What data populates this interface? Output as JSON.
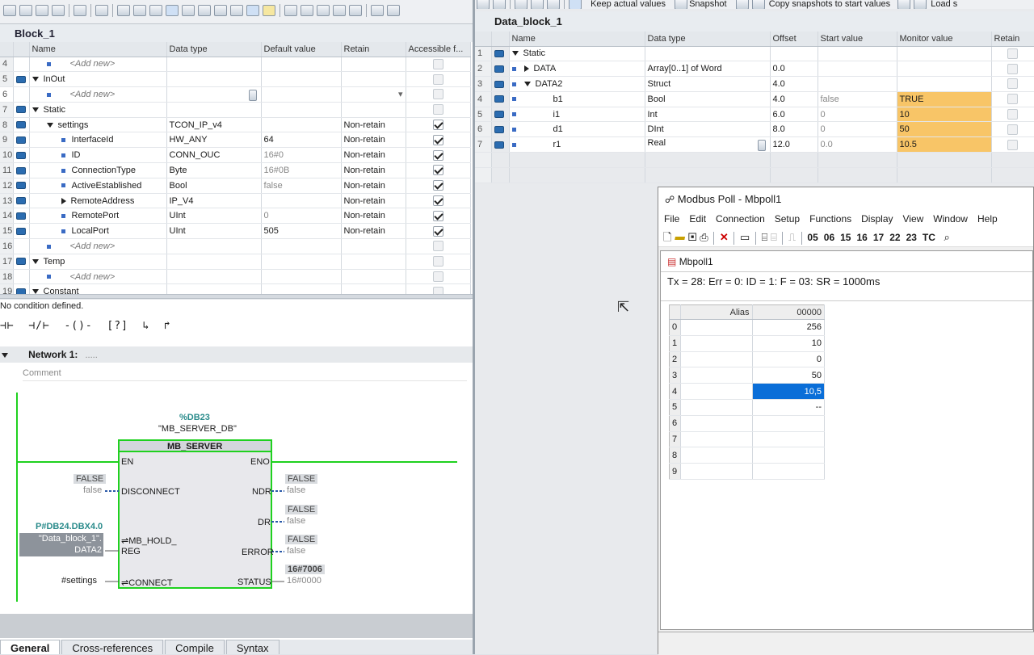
{
  "left": {
    "block_title": "Block_1",
    "columns": [
      "Name",
      "Data type",
      "Default value",
      "Retain",
      "Accessible f..."
    ],
    "rows": [
      {
        "num": "4",
        "indent": 1,
        "kind": "add",
        "name": "<Add new>",
        "type": "",
        "def": "",
        "retain": "",
        "cb": "dis"
      },
      {
        "num": "5",
        "indent": 0,
        "kind": "sec",
        "name": "InOut",
        "type": "",
        "def": "",
        "retain": "",
        "cb": "dis"
      },
      {
        "num": "6",
        "indent": 1,
        "kind": "add",
        "name": "<Add new>",
        "type": "",
        "def": "",
        "retain": "",
        "cb": "dis",
        "sel": true
      },
      {
        "num": "7",
        "indent": 0,
        "kind": "sec",
        "name": "Static",
        "type": "",
        "def": "",
        "retain": "",
        "cb": "dis"
      },
      {
        "num": "8",
        "indent": 1,
        "kind": "struct",
        "name": "settings",
        "type": "TCON_IP_v4",
        "def": "",
        "retain": "Non-retain",
        "cb": "on"
      },
      {
        "num": "9",
        "indent": 2,
        "kind": "var",
        "name": "InterfaceId",
        "type": "HW_ANY",
        "def": "64",
        "retain": "Non-retain",
        "cb": "on"
      },
      {
        "num": "10",
        "indent": 2,
        "kind": "var",
        "name": "ID",
        "type": "CONN_OUC",
        "def": "16#0",
        "retain": "Non-retain",
        "cb": "on",
        "grey": true
      },
      {
        "num": "11",
        "indent": 2,
        "kind": "var",
        "name": "ConnectionType",
        "type": "Byte",
        "def": "16#0B",
        "retain": "Non-retain",
        "cb": "on",
        "grey": true
      },
      {
        "num": "12",
        "indent": 2,
        "kind": "var",
        "name": "ActiveEstablished",
        "type": "Bool",
        "def": "false",
        "retain": "Non-retain",
        "cb": "on",
        "grey": true
      },
      {
        "num": "13",
        "indent": 2,
        "kind": "sub",
        "name": "RemoteAddress",
        "type": "IP_V4",
        "def": "",
        "retain": "Non-retain",
        "cb": "on"
      },
      {
        "num": "14",
        "indent": 2,
        "kind": "var",
        "name": "RemotePort",
        "type": "UInt",
        "def": "0",
        "retain": "Non-retain",
        "cb": "on",
        "grey": true
      },
      {
        "num": "15",
        "indent": 2,
        "kind": "var",
        "name": "LocalPort",
        "type": "UInt",
        "def": "505",
        "retain": "Non-retain",
        "cb": "on"
      },
      {
        "num": "16",
        "indent": 1,
        "kind": "add",
        "name": "<Add new>",
        "type": "",
        "def": "",
        "retain": "",
        "cb": "dis"
      },
      {
        "num": "17",
        "indent": 0,
        "kind": "sec",
        "name": "Temp",
        "type": "",
        "def": "",
        "retain": "",
        "cb": "dis"
      },
      {
        "num": "18",
        "indent": 1,
        "kind": "add",
        "name": "<Add new>",
        "type": "",
        "def": "",
        "retain": "",
        "cb": "dis"
      },
      {
        "num": "19",
        "indent": 0,
        "kind": "sec",
        "name": "Constant",
        "type": "",
        "def": "",
        "retain": "",
        "cb": "dis"
      }
    ],
    "condition": "No condition defined.",
    "network": {
      "label": "Network 1:",
      "dots": ".....",
      "comment": "Comment"
    },
    "lad": {
      "db_addr": "%DB23",
      "db_name": "\"MB_SERVER_DB\"",
      "block": "MB_SERVER",
      "en": "EN",
      "eno": "ENO",
      "disconnect": "DISCONNECT",
      "ndr": "NDR",
      "dr": "DR",
      "mb_hold": "MB_HOLD_",
      "reg": "REG",
      "error": "ERROR",
      "connect": "CONNECT",
      "status": "STATUS",
      "disc_val": "FALSE",
      "disc_sub": "false",
      "ndr_val": "FALSE",
      "ndr_sub": "false",
      "dr_val": "FALSE",
      "dr_sub": "false",
      "err_val": "FALSE",
      "err_sub": "false",
      "status_val": "16#7006",
      "status_sub": "16#0000",
      "hold_addr": "P#DB24.DBX4.0",
      "hold_line1": "\"Data_block_1\".",
      "hold_line2": "DATA2",
      "connect_var": "#settings"
    },
    "tabs": [
      "General",
      "Cross-references",
      "Compile",
      "Syntax"
    ]
  },
  "right": {
    "toolbar": {
      "keep": "Keep actual values",
      "snapshot": "Snapshot",
      "copy": "Copy snapshots to start values",
      "load": "Load s"
    },
    "block_title": "Data_block_1",
    "columns": [
      "Name",
      "Data type",
      "Offset",
      "Start value",
      "Monitor value",
      "Retain"
    ],
    "rows": [
      {
        "num": "1",
        "indent": 0,
        "kind": "sec",
        "name": "Static",
        "type": "",
        "offset": "",
        "start": "",
        "mon": ""
      },
      {
        "num": "2",
        "indent": 1,
        "kind": "sub",
        "name": "DATA",
        "type": "Array[0..1] of Word",
        "offset": "0.0",
        "start": "",
        "mon": ""
      },
      {
        "num": "3",
        "indent": 1,
        "kind": "struct",
        "name": "DATA2",
        "type": "Struct",
        "offset": "4.0",
        "start": "",
        "mon": ""
      },
      {
        "num": "4",
        "indent": 2,
        "kind": "var",
        "name": "b1",
        "type": "Bool",
        "offset": "4.0",
        "start": "false",
        "mon": "TRUE"
      },
      {
        "num": "5",
        "indent": 2,
        "kind": "var",
        "name": "i1",
        "type": "Int",
        "offset": "6.0",
        "start": "0",
        "mon": "10"
      },
      {
        "num": "6",
        "indent": 2,
        "kind": "var",
        "name": "d1",
        "type": "DInt",
        "offset": "8.0",
        "start": "0",
        "mon": "50"
      },
      {
        "num": "7",
        "indent": 2,
        "kind": "var",
        "name": "r1",
        "type": "Real",
        "offset": "12.0",
        "start": "0.0",
        "mon": "10.5"
      }
    ]
  },
  "modbus": {
    "title": "Modbus Poll - Mbpoll1",
    "menu": [
      "File",
      "Edit",
      "Connection",
      "Setup",
      "Functions",
      "Display",
      "View",
      "Window",
      "Help"
    ],
    "fcodes": [
      "05",
      "06",
      "15",
      "16",
      "17",
      "22",
      "23",
      "TC"
    ],
    "child_title": "Mbpoll1",
    "status": "Tx = 28: Err = 0: ID = 1: F = 03: SR = 1000ms",
    "alias_header": "Alias",
    "value_header": "00000",
    "rows": [
      {
        "i": "0",
        "v": "256"
      },
      {
        "i": "1",
        "v": "10"
      },
      {
        "i": "2",
        "v": "0"
      },
      {
        "i": "3",
        "v": "50"
      },
      {
        "i": "4",
        "v": "10,5",
        "sel": true
      },
      {
        "i": "5",
        "v": "--"
      },
      {
        "i": "6",
        "v": ""
      },
      {
        "i": "7",
        "v": ""
      },
      {
        "i": "8",
        "v": ""
      },
      {
        "i": "9",
        "v": ""
      }
    ]
  }
}
